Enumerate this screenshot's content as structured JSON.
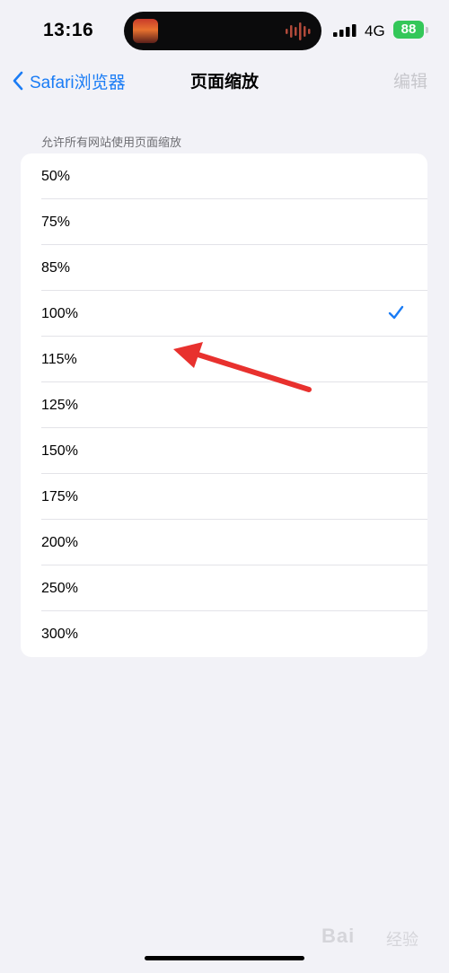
{
  "status_bar": {
    "time": "13:16",
    "network": "4G",
    "battery": "88"
  },
  "nav": {
    "back_label": "Safari浏览器",
    "title": "页面缩放",
    "edit_label": "编辑"
  },
  "section": {
    "header": "允许所有网站使用页面缩放",
    "options": [
      "50%",
      "75%",
      "85%",
      "100%",
      "115%",
      "125%",
      "150%",
      "175%",
      "200%",
      "250%",
      "300%"
    ],
    "selected": "100%"
  },
  "watermark": {
    "brand": "Bai",
    "sub": "经验"
  },
  "colors": {
    "accent": "#1a7cf5",
    "background": "#f2f2f7",
    "battery": "#34c759",
    "annotation_arrow": "#e8312e"
  }
}
